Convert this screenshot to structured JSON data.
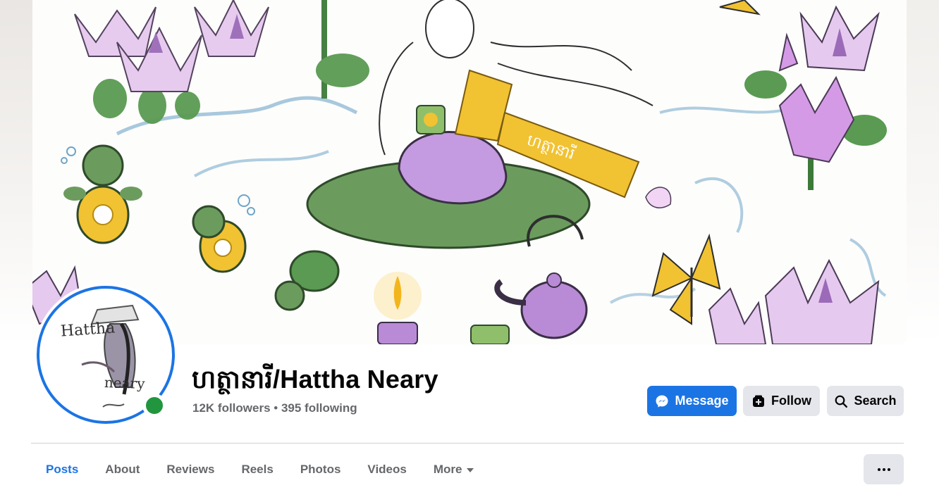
{
  "profile": {
    "name": "ហត្ថានារី/Hattha Neary",
    "followers_text": "12K followers",
    "separator": " • ",
    "following_text": "395 following",
    "avatar_text_top": "Hattha",
    "avatar_text_bottom": "neary",
    "online": true
  },
  "actions": {
    "message_label": "Message",
    "follow_label": "Follow",
    "search_label": "Search"
  },
  "tabs": [
    {
      "label": "Posts",
      "active": true
    },
    {
      "label": "About",
      "active": false
    },
    {
      "label": "Reviews",
      "active": false
    },
    {
      "label": "Reels",
      "active": false
    },
    {
      "label": "Photos",
      "active": false
    },
    {
      "label": "Videos",
      "active": false
    },
    {
      "label": "More",
      "active": false
    }
  ],
  "colors": {
    "accent": "#1b74e4",
    "online": "#22963e",
    "secondary_button": "#e4e6eb",
    "muted_text": "#65676b"
  },
  "icons": {
    "message": "messenger-icon",
    "follow": "follow-icon",
    "search": "search-icon",
    "more_tab": "caret-down-icon",
    "overflow": "more-dots-icon"
  }
}
